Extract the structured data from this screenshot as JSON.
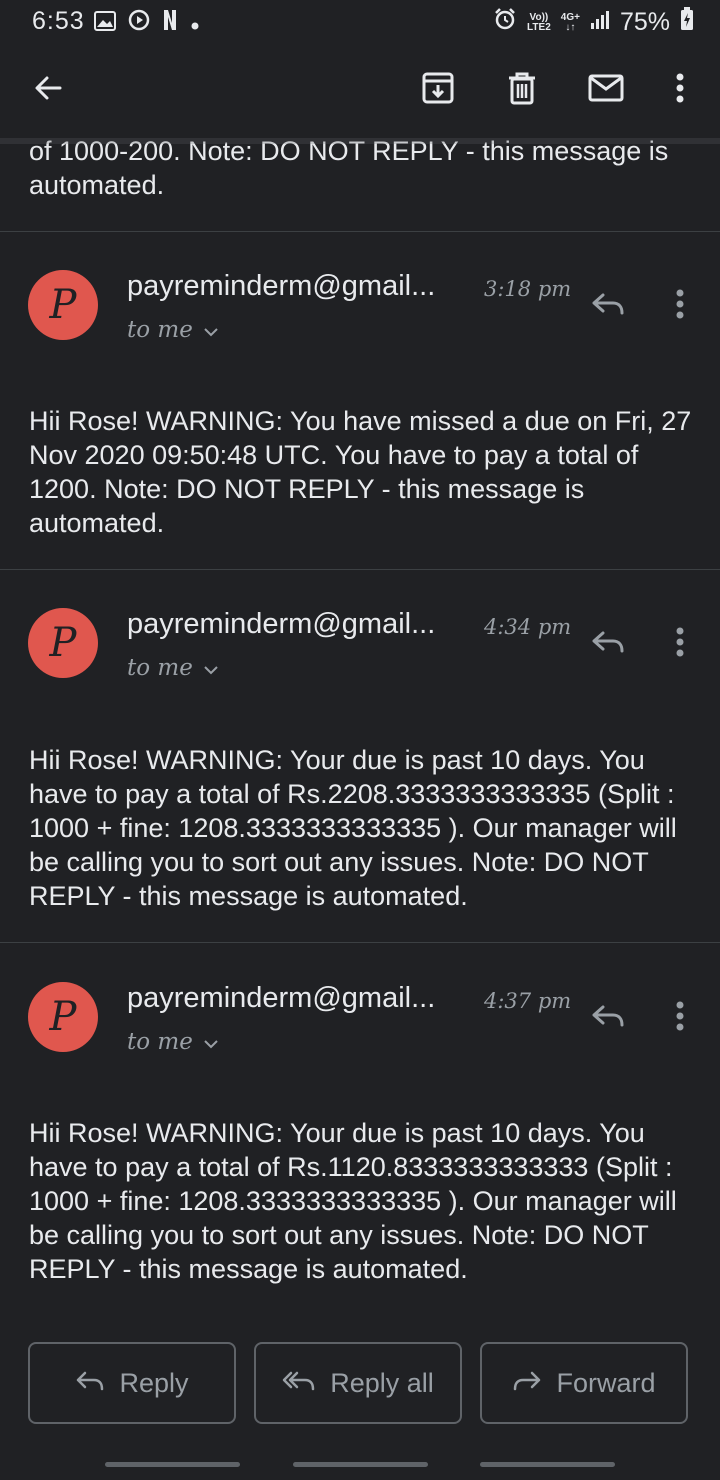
{
  "status_bar": {
    "time": "6:53",
    "carrier_top": "Vo))",
    "carrier_bottom": "LTE2",
    "network_top": "4G+",
    "battery": "75%"
  },
  "toolbar": {
    "back_icon": "arrow-left-icon",
    "archive_icon": "archive-icon",
    "delete_icon": "trash-icon",
    "mark_unread_icon": "mail-icon",
    "more_icon": "more-vertical-icon"
  },
  "previous_tail": "of 1000-200. Note: DO NOT REPLY - this message is automated.",
  "messages": [
    {
      "avatar_letter": "P",
      "sender": "payreminderm@gmail...",
      "time": "3:18 pm",
      "recipient": "to me",
      "body": "Hii Rose! WARNING: You have missed a due on Fri, 27 Nov 2020 09:50:48 UTC. You have to pay a total of 1200. Note: DO NOT REPLY - this message is automated."
    },
    {
      "avatar_letter": "P",
      "sender": "payreminderm@gmail...",
      "time": "4:34 pm",
      "recipient": "to me",
      "body": "Hii Rose! WARNING: Your due is past 10 days. You have to pay a total of Rs.2208.3333333333335 (Split : 1000 + fine: 1208.3333333333335 ). Our manager will be calling you to sort out any issues. Note: DO NOT REPLY - this message is automated."
    },
    {
      "avatar_letter": "P",
      "sender": "payreminderm@gmail...",
      "time": "4:37 pm",
      "recipient": "to me",
      "body": "Hii Rose! WARNING: Your due is past 10 days. You have to pay a total of Rs.1120.8333333333333 (Split : 1000 + fine: 1208.3333333333335 ). Our manager will be calling you to sort out any issues. Note: DO NOT REPLY - this message is automated."
    }
  ],
  "actions": {
    "reply": "Reply",
    "reply_all": "Reply all",
    "forward": "Forward"
  },
  "colors": {
    "background": "#202124",
    "text": "#e8eaed",
    "muted": "#9aa0a6",
    "avatar": "#e0574e",
    "border": "#5f6368"
  }
}
